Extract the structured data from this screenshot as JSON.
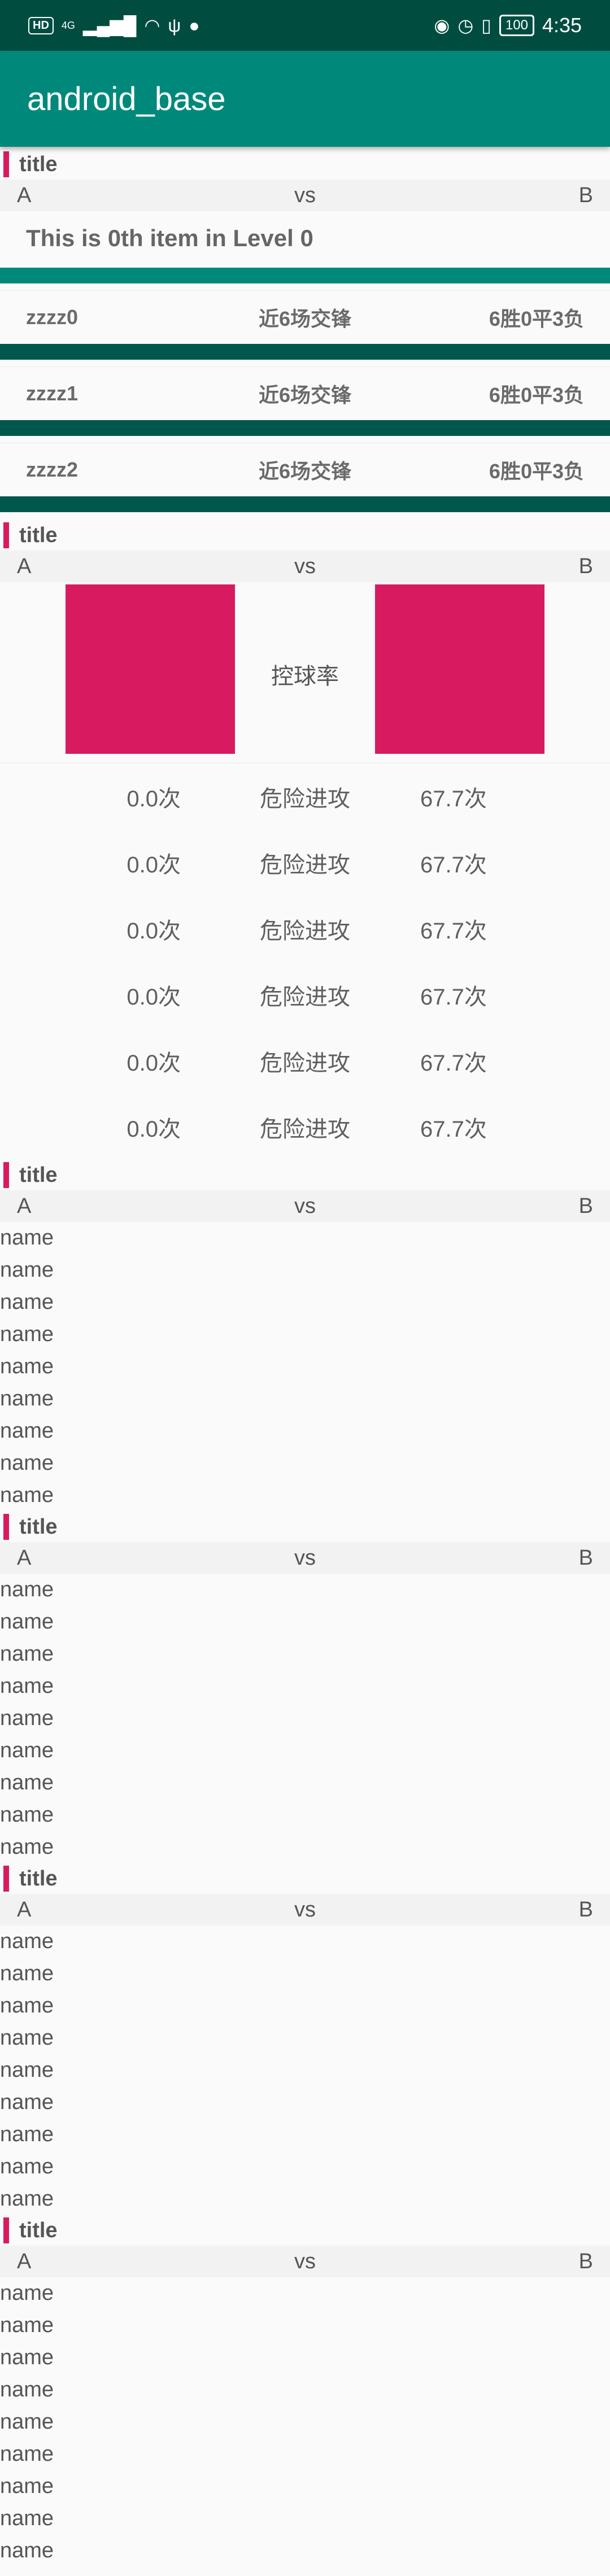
{
  "status_bar": {
    "hd": "HD",
    "signal": "4G",
    "battery": "100",
    "time": "4:35"
  },
  "app_bar": {
    "title": "android_base"
  },
  "section1": {
    "title": "title",
    "vs": {
      "left": "A",
      "mid": "vs",
      "right": "B"
    },
    "level_text": "This is 0th item in Level 0",
    "matches": [
      {
        "name": "zzzz0",
        "mid": "近6场交锋",
        "result": "6胜0平3负"
      },
      {
        "name": "zzzz1",
        "mid": "近6场交锋",
        "result": "6胜0平3负"
      },
      {
        "name": "zzzz2",
        "mid": "近6场交锋",
        "result": "6胜0平3负"
      }
    ]
  },
  "section2": {
    "title": "title",
    "vs": {
      "left": "A",
      "mid": "vs",
      "right": "B"
    },
    "chart_label": "控球率",
    "stats": [
      {
        "left": "0.0次",
        "mid": "危险进攻",
        "right": "67.7次"
      },
      {
        "left": "0.0次",
        "mid": "危险进攻",
        "right": "67.7次"
      },
      {
        "left": "0.0次",
        "mid": "危险进攻",
        "right": "67.7次"
      },
      {
        "left": "0.0次",
        "mid": "危险进攻",
        "right": "67.7次"
      },
      {
        "left": "0.0次",
        "mid": "危险进攻",
        "right": "67.7次"
      },
      {
        "left": "0.0次",
        "mid": "危险进攻",
        "right": "67.7次"
      }
    ]
  },
  "name_sections": [
    {
      "title": "title",
      "vs": {
        "left": "A",
        "mid": "vs",
        "right": "B"
      },
      "names": [
        "name",
        "name",
        "name",
        "name",
        "name",
        "name",
        "name",
        "name",
        "name"
      ]
    },
    {
      "title": "title",
      "vs": {
        "left": "A",
        "mid": "vs",
        "right": "B"
      },
      "names": [
        "name",
        "name",
        "name",
        "name",
        "name",
        "name",
        "name",
        "name",
        "name"
      ]
    },
    {
      "title": "title",
      "vs": {
        "left": "A",
        "mid": "vs",
        "right": "B"
      },
      "names": [
        "name",
        "name",
        "name",
        "name",
        "name",
        "name",
        "name",
        "name",
        "name"
      ]
    },
    {
      "title": "title",
      "vs": {
        "left": "A",
        "mid": "vs",
        "right": "B"
      },
      "names": [
        "name",
        "name",
        "name",
        "name",
        "name",
        "name",
        "name",
        "name",
        "name"
      ]
    }
  ],
  "colors": {
    "accent": "#d81b60",
    "primary": "#00897b",
    "primary_dark": "#00574b",
    "status_bar": "#004d40"
  }
}
